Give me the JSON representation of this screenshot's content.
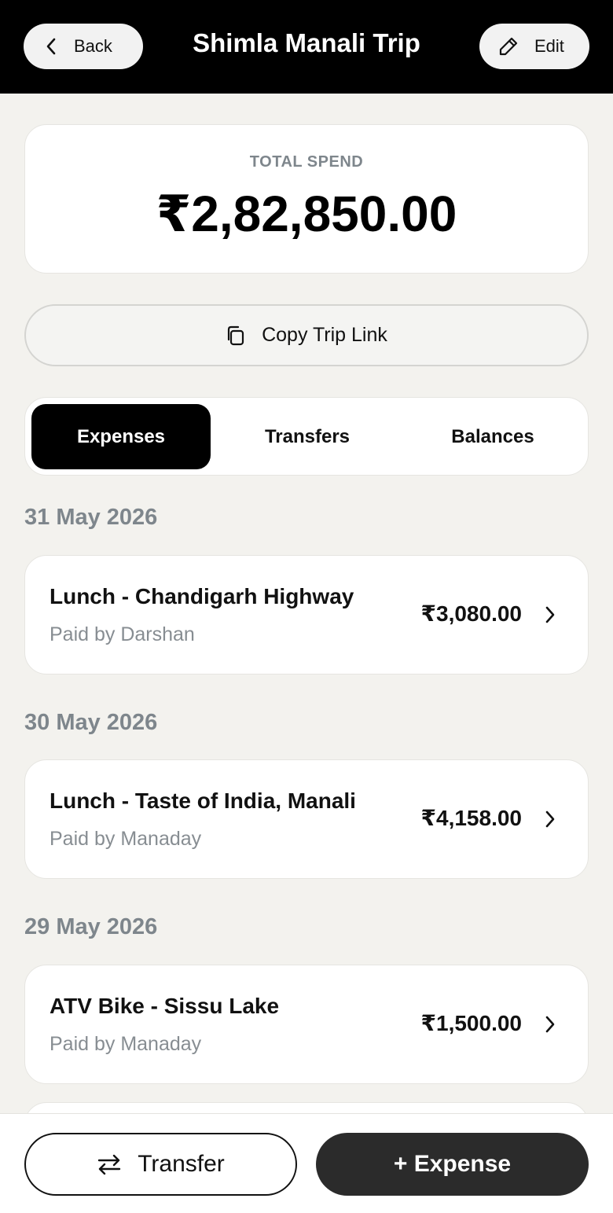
{
  "header": {
    "title": "Shimla Manali Trip",
    "back_label": "Back",
    "edit_label": "Edit"
  },
  "total": {
    "label": "TOTAL SPEND",
    "value": "₹2,82,850.00"
  },
  "copy_link": {
    "label": "Copy Trip Link"
  },
  "tabs": [
    {
      "label": "Expenses",
      "active": true
    },
    {
      "label": "Transfers",
      "active": false
    },
    {
      "label": "Balances",
      "active": false
    }
  ],
  "groups": [
    {
      "date": "31 May 2026",
      "expenses": [
        {
          "title": "Lunch - Chandigarh Highway",
          "paid_by": "Paid by Darshan",
          "amount": "₹3,080.00"
        }
      ]
    },
    {
      "date": "30 May 2026",
      "expenses": [
        {
          "title": "Lunch - Taste of India, Manali",
          "paid_by": "Paid by Manaday",
          "amount": "₹4,158.00"
        }
      ]
    },
    {
      "date": "29 May 2026",
      "expenses": [
        {
          "title": "ATV Bike - Sissu Lake",
          "paid_by": "Paid by Manaday",
          "amount": "₹1,500.00"
        }
      ]
    }
  ],
  "actions": {
    "transfer_label": "Transfer",
    "add_expense_label": "+ Expense"
  },
  "icons": {
    "back": "chevron-left-icon",
    "edit": "pencil-icon",
    "copy": "copy-icon",
    "row": "chevron-right-icon",
    "transfer": "swap-arrows-icon"
  },
  "colors": {
    "header_bg": "#000000",
    "page_bg": "#f3f2ee",
    "card_bg": "#ffffff",
    "muted_text": "#7e868c",
    "primary_button": "#2b2b2b"
  }
}
